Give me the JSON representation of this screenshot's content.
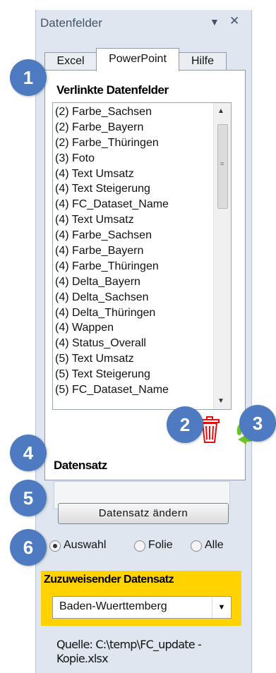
{
  "panel": {
    "title": "Datenfelder",
    "pin_icon": "dropdown-triangle-icon",
    "close_icon": "close-icon"
  },
  "tabs": [
    {
      "label": "Excel"
    },
    {
      "label": "PowerPoint",
      "active": true
    },
    {
      "label": "Hilfe"
    }
  ],
  "linked_fields": {
    "heading": "Verlinkte Datenfelder",
    "items": [
      "(2) Farbe_Sachsen",
      "(2) Farbe_Bayern",
      "(2) Farbe_Thüringen",
      "(3) Foto",
      "(4) Text Umsatz",
      "(4) Text Steigerung",
      "(4) FC_Dataset_Name",
      "(4) Text Umsatz",
      "(4) Farbe_Sachsen",
      "(4) Farbe_Bayern",
      "(4) Farbe_Thüringen",
      "(4) Delta_Bayern",
      "(4) Delta_Sachsen",
      "(4) Delta_Thüringen",
      "(4) Wappen",
      "(4) Status_Overall",
      "(5) Text Umsatz",
      "(5) Text Steigerung",
      "(5) FC_Dataset_Name"
    ]
  },
  "dataset": {
    "heading": "Datensatz",
    "value": "",
    "change_button": "Datensatz ändern",
    "radio": [
      {
        "label": "Auswahl",
        "checked": true
      },
      {
        "label": "Folie",
        "checked": false
      },
      {
        "label": "Alle",
        "checked": false
      }
    ]
  },
  "assign": {
    "heading": "Zuzuweisender Datensatz",
    "selected": "Baden-Wuerttemberg",
    "highlight_color": "#ffd200"
  },
  "source_text": "Quelle: C:\\temp\\FC_update - Kopie.xlsx",
  "badges": [
    "1",
    "2",
    "3",
    "4",
    "5",
    "6"
  ],
  "badge_color": "#4d7ac0",
  "icons": {
    "delete": "trash-icon",
    "refresh": "refresh-arrows-icon"
  }
}
